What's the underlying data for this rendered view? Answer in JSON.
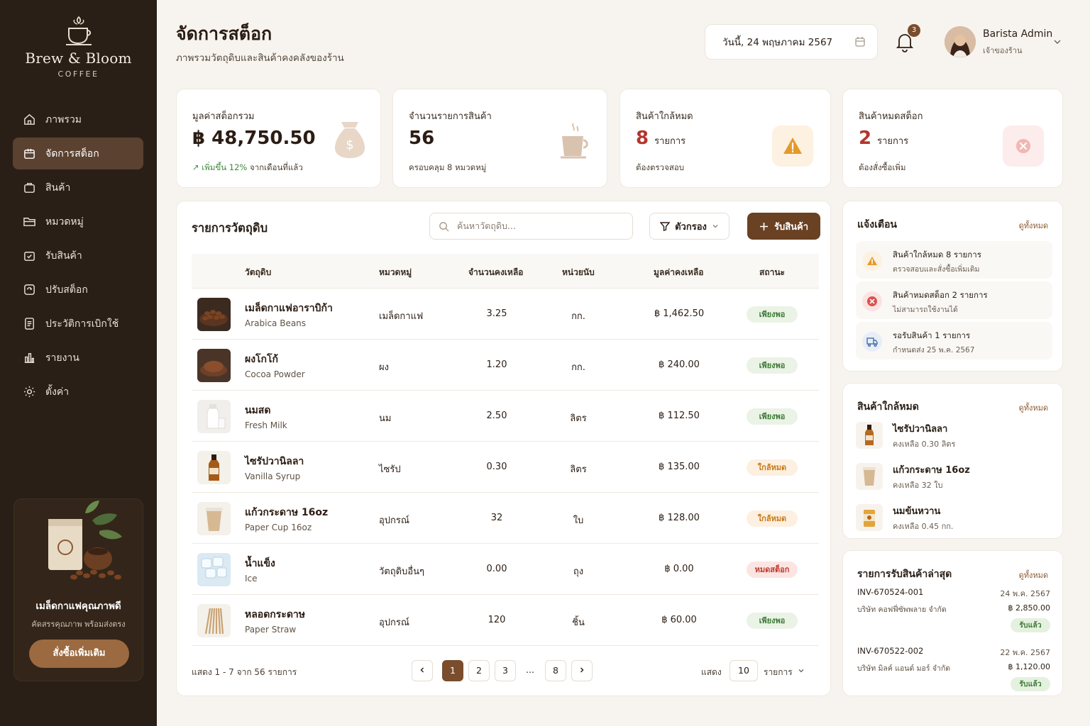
{
  "brand": {
    "name": "Brew & Bloom",
    "sub": "COFFEE"
  },
  "nav": [
    {
      "label": "ภาพรวม",
      "icon": "home-icon"
    },
    {
      "label": "จัดการสต็อก",
      "icon": "box-icon",
      "active": true
    },
    {
      "label": "สินค้า",
      "icon": "bag-icon"
    },
    {
      "label": "หมวดหมู่",
      "icon": "folder-icon"
    },
    {
      "label": "รับสินค้า",
      "icon": "receive-icon"
    },
    {
      "label": "ปรับสต็อก",
      "icon": "adjust-icon"
    },
    {
      "label": "ประวัติการเบิกใช้",
      "icon": "history-icon"
    },
    {
      "label": "รายงาน",
      "icon": "chart-icon"
    },
    {
      "label": "ตั้งค่า",
      "icon": "gear-icon"
    }
  ],
  "promo": {
    "title": "เมล็ดกาแฟคุณภาพดี",
    "sub": "คัดสรรคุณภาพ พร้อมส่งตรง",
    "button": "สั่งซื้อเพิ่มเติม"
  },
  "header": {
    "title": "จัดการสต็อก",
    "subtitle": "ภาพรวมวัตถุดิบและสินค้าคงคลังของร้าน",
    "date": "วันนี้, 24 พฤษภาคม 2567",
    "notif_count": "3"
  },
  "user": {
    "name": "Barista Admin",
    "role": "เจ้าของร้าน"
  },
  "stats": [
    {
      "label": "มูลค่าสต็อกรวม",
      "value": "฿ 48,750.50",
      "unit": "",
      "note_strong": "↗ เพิ่มขึ้น 12%",
      "note": " จากเดือนที่แล้ว"
    },
    {
      "label": "จำนวนรายการสินค้า",
      "value": "56",
      "unit": "",
      "note": "ครอบคลุม 8 หมวดหมู่"
    },
    {
      "label": "สินค้าใกล้หมด",
      "value": "8",
      "unit": "รายการ",
      "note": "ต้องตรวจสอบ"
    },
    {
      "label": "สินค้าหมดสต็อก",
      "value": "2",
      "unit": "รายการ",
      "note": "ต้องสั่งซื้อเพิ่ม"
    }
  ],
  "table": {
    "title": "รายการวัตถุดิบ",
    "search_placeholder": "ค้นหาวัตถุดิบ...",
    "filter": "ตัวกรอง",
    "add": "รับสินค้า",
    "headers": [
      "วัตถุดิบ",
      "หมวดหมู่",
      "จำนวนคงเหลือ",
      "หน่วยนับ",
      "มูลค่าคงเหลือ",
      "สถานะ"
    ],
    "rows": [
      {
        "th": "เมล็ดกาแฟอาราบิก้า",
        "en": "Arabica Beans",
        "cat": "เมล็ดกาแฟ",
        "qty": "3.25",
        "unit": "กก.",
        "value": "฿ 1,462.50",
        "status": "เพียงพอ",
        "kind": "ok",
        "thumb": "beans"
      },
      {
        "th": "ผงโกโก้",
        "en": "Cocoa Powder",
        "cat": "ผง",
        "qty": "1.20",
        "unit": "กก.",
        "value": "฿ 240.00",
        "status": "เพียงพอ",
        "kind": "ok",
        "thumb": "cocoa"
      },
      {
        "th": "นมสด",
        "en": "Fresh Milk",
        "cat": "นม",
        "qty": "2.50",
        "unit": "ลิตร",
        "value": "฿ 112.50",
        "status": "เพียงพอ",
        "kind": "ok",
        "thumb": "milk"
      },
      {
        "th": "ไซรัปวานิลลา",
        "en": "Vanilla Syrup",
        "cat": "ไซรัป",
        "qty": "0.30",
        "unit": "ลิตร",
        "value": "฿ 135.00",
        "status": "ใกล้หมด",
        "kind": "low",
        "thumb": "syrup"
      },
      {
        "th": "แก้วกระดาษ 16oz",
        "en": "Paper Cup 16oz",
        "cat": "อุปกรณ์",
        "qty": "32",
        "unit": "ใบ",
        "value": "฿ 128.00",
        "status": "ใกล้หมด",
        "kind": "low",
        "thumb": "cup"
      },
      {
        "th": "น้ำแข็ง",
        "en": "Ice",
        "cat": "วัตถุดิบอื่นๆ",
        "qty": "0.00",
        "unit": "ถุง",
        "value": "฿ 0.00",
        "status": "หมดสต็อก",
        "kind": "out",
        "thumb": "ice"
      },
      {
        "th": "หลอดกระดาษ",
        "en": "Paper Straw",
        "cat": "อุปกรณ์",
        "qty": "120",
        "unit": "ชิ้น",
        "value": "฿ 60.00",
        "status": "เพียงพอ",
        "kind": "ok",
        "thumb": "straw"
      }
    ],
    "pager_info": "แสดง 1 - 7 จาก 56 รายการ",
    "pages": [
      "1",
      "2",
      "3",
      "...",
      "8"
    ],
    "per_label": "แสดง",
    "per_value": "10",
    "per_unit": "รายการ"
  },
  "alerts": {
    "title": "แจ้งเตือน",
    "link": "ดูทั้งหมด",
    "items": [
      {
        "title": "สินค้าใกล้หมด 8 รายการ",
        "sub": "ตรวจสอบและสั่งซื้อเพิ่มเติม",
        "icon": "warning-icon"
      },
      {
        "title": "สินค้าหมดสต็อก 2 รายการ",
        "sub": "ไม่สามารถใช้งานได้",
        "icon": "error-icon"
      },
      {
        "title": "รอรับสินค้า 1 รายการ",
        "sub": "กำหนดส่ง 25 พ.ค. 2567",
        "icon": "truck-icon"
      }
    ]
  },
  "low": {
    "title": "สินค้าใกล้หมด",
    "link": "ดูทั้งหมด",
    "items": [
      {
        "name": "ไซรัปวานิลลา",
        "sub": "คงเหลือ 0.30 ลิตร"
      },
      {
        "name": "แก้วกระดาษ 16oz",
        "sub": "คงเหลือ 32 ใบ"
      },
      {
        "name": "นมข้นหวาน",
        "sub": "คงเหลือ 0.45 กก."
      }
    ]
  },
  "receipts": {
    "title": "รายการรับสินค้าล่าสุด",
    "link": "ดูทั้งหมด",
    "items": [
      {
        "id": "INV-670524-001",
        "date": "24 พ.ค. 2567",
        "company": "บริษัท คอฟฟี่ซัพพลาย จำกัด",
        "amount": "฿ 2,850.00",
        "status": "รับแล้ว"
      },
      {
        "id": "INV-670522-002",
        "date": "22 พ.ค. 2567",
        "company": "บริษัท มิลค์ แอนด์ มอร์ จำกัด",
        "amount": "฿ 1,120.00",
        "status": "รับแล้ว"
      }
    ]
  },
  "colors": {
    "sidebar": "#2a1f17",
    "accent": "#6a4122",
    "ok": "#3e7a36",
    "low": "#c77a1a",
    "out": "#c0392b"
  }
}
